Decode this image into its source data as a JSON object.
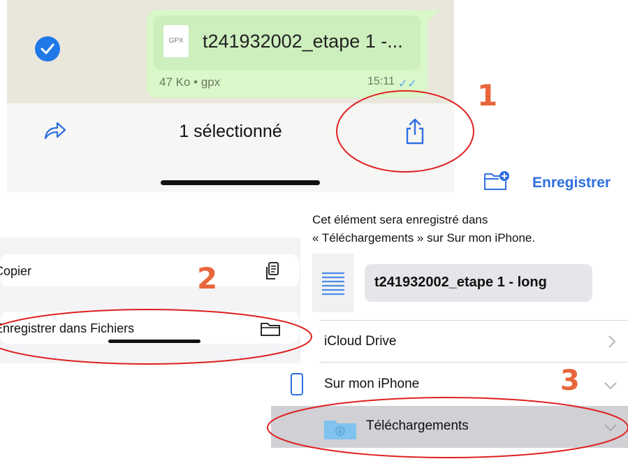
{
  "whatsapp": {
    "file": {
      "type_badge": "GPX",
      "name": "t241932002_etape 1 -...",
      "meta": "47 Ko • gpx",
      "time": "15:11"
    },
    "toolbar": {
      "selected_label": "1 sélectionné",
      "forward_icon": "forward-arrow-icon",
      "share_icon": "share-icon"
    }
  },
  "share_sheet": {
    "items": [
      {
        "label": "Copier",
        "icon": "copy-icon"
      },
      {
        "label": "Enregistrer dans Fichiers",
        "icon": "folder-icon"
      }
    ]
  },
  "files_save": {
    "new_folder_icon": "folder-plus-icon",
    "save_label": "Enregistrer",
    "info_line1": "Cet élément sera enregistré dans",
    "info_line2": "« Téléchargements » sur Sur mon iPhone.",
    "filename": "t241932002_etape 1 - long",
    "locations": [
      {
        "label": "iCloud Drive"
      },
      {
        "label": "Sur mon iPhone"
      },
      {
        "label": "Téléchargements",
        "selected": true
      }
    ]
  },
  "annotations": {
    "step1": "1",
    "step2": "2",
    "step3": "3",
    "color": "#e8663b",
    "circle_color": "#e02020"
  },
  "colors": {
    "ios_blue": "#2f6fe0",
    "bubble_green": "#d9f7c9",
    "check_blue": "#1f78e8"
  }
}
